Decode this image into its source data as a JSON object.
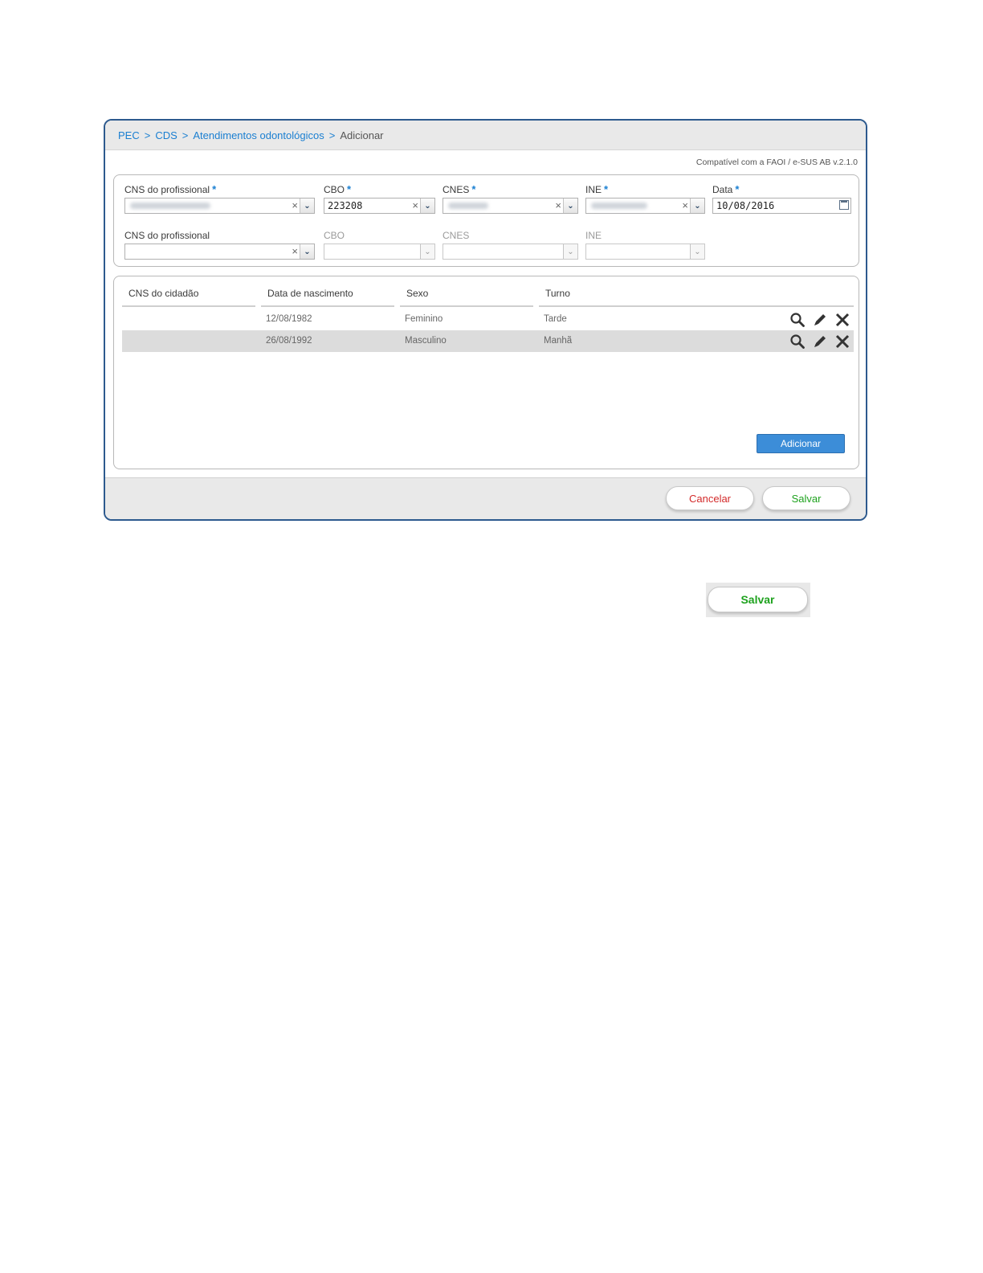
{
  "breadcrumb": {
    "items": [
      "PEC",
      "CDS",
      "Atendimentos odontológicos"
    ],
    "separator": ">",
    "current": "Adicionar"
  },
  "compat_text": "Compatível com a FAOI / e-SUS AB v.2.1.0",
  "form": {
    "row1": {
      "cns": {
        "label": "CNS do profissional",
        "required_mark": "*"
      },
      "cbo": {
        "label": "CBO",
        "required_mark": "*",
        "value": "223208"
      },
      "cnes": {
        "label": "CNES",
        "required_mark": "*"
      },
      "ine": {
        "label": "INE",
        "required_mark": "*"
      },
      "data": {
        "label": "Data",
        "required_mark": "*",
        "value": "10/08/2016"
      }
    },
    "row2": {
      "cns": {
        "label": "CNS do profissional"
      },
      "cbo": {
        "label": "CBO"
      },
      "cnes": {
        "label": "CNES"
      },
      "ine": {
        "label": "INE"
      }
    },
    "clear_glyph": "×",
    "dropdown_glyph": "⌄"
  },
  "table": {
    "headers": [
      "CNS do cidadão",
      "Data de nascimento",
      "Sexo",
      "Turno"
    ],
    "rows": [
      {
        "cns": "",
        "nascimento": "12/08/1982",
        "sexo": "Feminino",
        "turno": "Tarde"
      },
      {
        "cns": "",
        "nascimento": "26/08/1992",
        "sexo": "Masculino",
        "turno": "Manhã"
      }
    ],
    "actions": [
      "search-icon",
      "edit-icon",
      "delete-icon"
    ],
    "add_label": "Adicionar"
  },
  "footer": {
    "cancel_label": "Cancelar",
    "save_label": "Salvar"
  },
  "callout": {
    "save_label": "Salvar"
  },
  "colors": {
    "link": "#1a7fd1",
    "primary_button": "#3c8dd8",
    "cancel_text": "#d32a2a",
    "save_text": "#1ea21e",
    "window_border": "#2d5a8e"
  }
}
